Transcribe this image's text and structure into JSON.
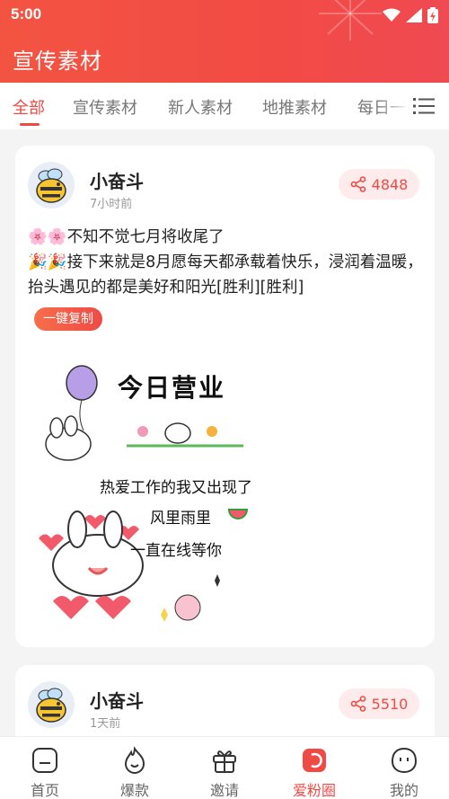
{
  "status_bar": {
    "time": "5:00"
  },
  "header": {
    "title": "宣传素材"
  },
  "tabs": [
    {
      "label": "全部",
      "active": true
    },
    {
      "label": "宣传素材"
    },
    {
      "label": "新人素材"
    },
    {
      "label": "地推素材"
    },
    {
      "label": "每日一"
    }
  ],
  "posts": [
    {
      "author": "小奋斗",
      "time": "7小时前",
      "shares": "4848",
      "text_line1": "🌸🌸不知不觉七月将收尾了",
      "text_line2": "🎉🎉接下来就是8月愿每天都承载着快乐，浸润着温暖，抬头遇见的都是美好和阳光[胜利][胜利]",
      "copy_label": "一键复制",
      "poster": {
        "title": "今日营业",
        "line1": "热爱工作的我又出现了",
        "line2": "风里雨里",
        "line3": "一直在线等你"
      }
    },
    {
      "author": "小奋斗",
      "time": "1天前",
      "shares": "5510"
    }
  ],
  "bottom_nav": [
    {
      "label": "首页",
      "icon": "home-icon"
    },
    {
      "label": "爆款",
      "icon": "flame-icon"
    },
    {
      "label": "邀请",
      "icon": "gift-icon"
    },
    {
      "label": "爱粉圈",
      "icon": "fan-circle-icon",
      "active": true
    },
    {
      "label": "我的",
      "icon": "profile-icon"
    }
  ],
  "colors": {
    "accent": "#f04a45",
    "header_bg": "#f35442",
    "share_pill_bg": "#fdeceb"
  }
}
